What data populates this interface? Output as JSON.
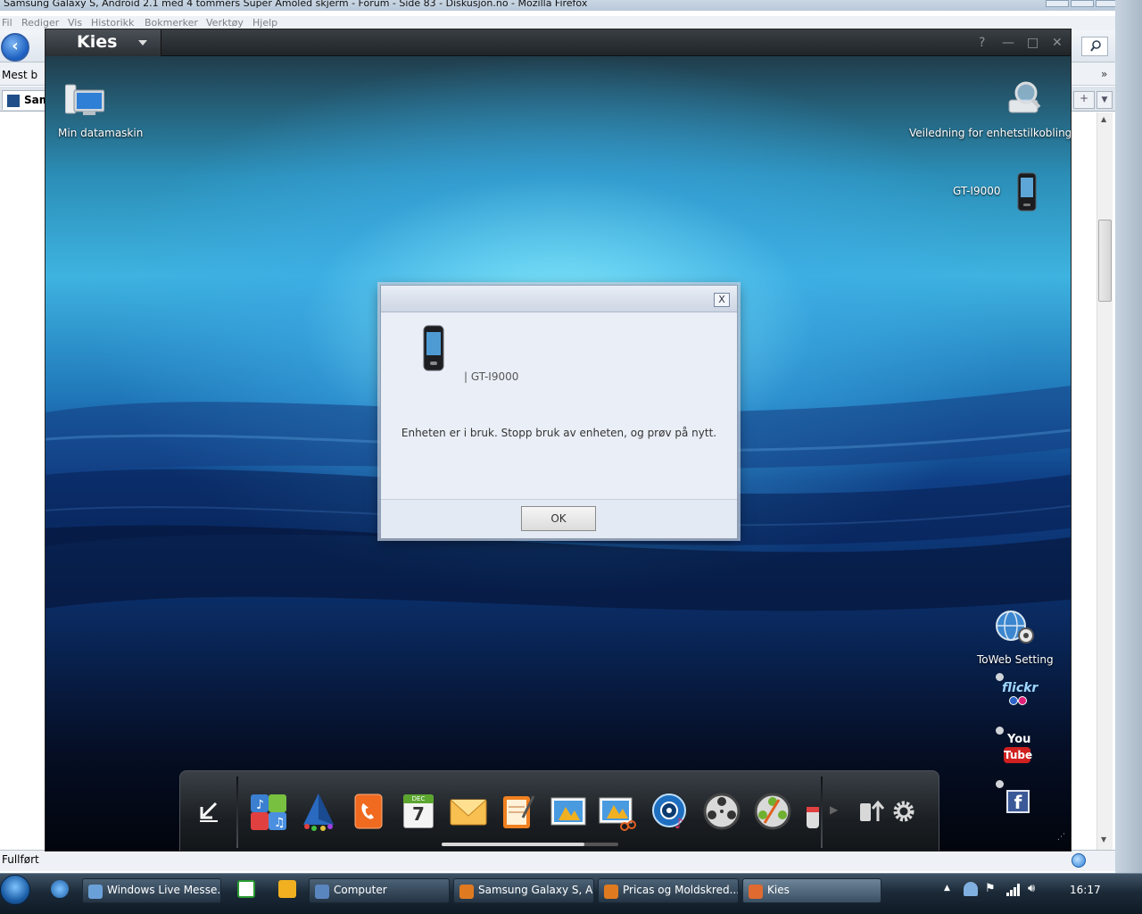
{
  "firefox": {
    "window_title": "Samsung Galaxy S, Android 2.1 med 4 tommers Super Amoled skjerm - Forum - Side 83 - Diskusjon.no - Mozilla Firefox",
    "menu": [
      "Fil",
      "Rediger",
      "Vis",
      "Historikk",
      "Bokmerker",
      "Verktøy",
      "Hjelp"
    ],
    "bookmarks_label": "Mest b",
    "bookmarks_overflow": "»",
    "tab_label": "Sam",
    "status_text": "Fullført"
  },
  "kies": {
    "app_name": "Kies",
    "controls": {
      "help": "?",
      "minimize": "—",
      "maximize": "□",
      "close": "✕"
    },
    "desktop": {
      "my_computer": "Min datamaskin",
      "connection_guide": "Veiledning for enhetstilkobling",
      "device_name": "GT-I9000"
    },
    "web": {
      "toweb_label": "ToWeb Setting",
      "flickr": "flickr",
      "youtube_you": "You",
      "youtube_tube": "Tube",
      "facebook": "f"
    },
    "dialog": {
      "close": "X",
      "model": "|   GT-I9000",
      "message": "Enheten er i bruk. Stopp bruk av enheten, og prøv på nytt.",
      "ok_label": "OK"
    },
    "dock": {
      "calendar_month": "DEC",
      "calendar_day": "7",
      "progress_fraction": 0.81,
      "icons": [
        "import-icon",
        "music-library-icon",
        "triangle-app-icon",
        "contacts-icon",
        "calendar-icon",
        "message-icon",
        "memo-icon",
        "photo-icon",
        "photo-edit-icon",
        "podcast-icon",
        "video-icon",
        "video-edit-icon",
        "more-icon",
        "sync-icon",
        "settings-icon"
      ]
    }
  },
  "taskbar": {
    "buttons": [
      {
        "label": "Windows Live Messe...",
        "color": "#6aa0d8"
      },
      {
        "label": "Computer",
        "color": "#5a86c0"
      },
      {
        "label": "Samsung Galaxy S, A...",
        "color": "#e07a20"
      },
      {
        "label": "Pricas og Moldskred...",
        "color": "#e07a20"
      },
      {
        "label": "Kies",
        "color": "#e06a30"
      }
    ],
    "clock": "16:17"
  }
}
